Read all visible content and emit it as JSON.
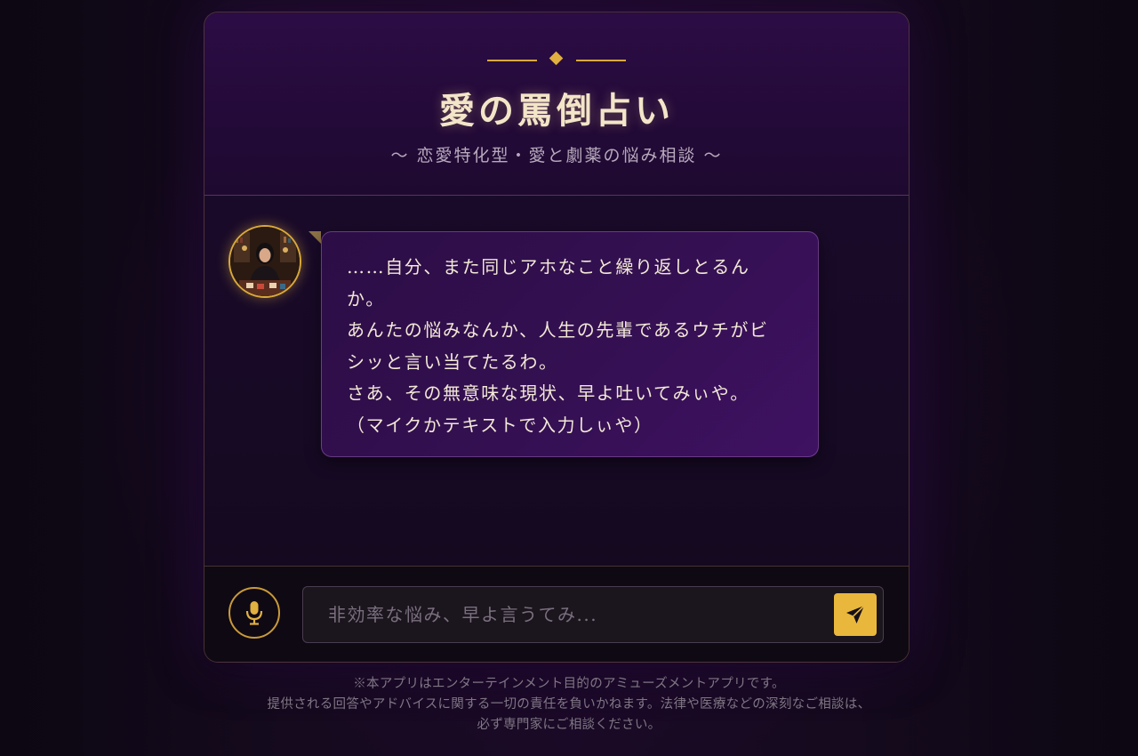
{
  "header": {
    "title": "愛の罵倒占い",
    "subtitle": "〜 恋愛特化型・愛と劇薬の悩み相談 〜"
  },
  "chat": {
    "messages": [
      {
        "sender": "fortune-teller",
        "text": "……自分、また同じアホなこと繰り返しとるん\nか。\nあんたの悩みなんか、人生の先輩であるウチがビ\nシッと言い当てたるわ。\nさあ、その無意味な現状、早よ吐いてみぃや。\n（マイクかテキストで入力しぃや）"
      }
    ]
  },
  "input": {
    "placeholder": "非効率な悩み、早よ言うてみ...",
    "value": ""
  },
  "disclaimer": {
    "line1": "※本アプリはエンターテインメント目的のアミューズメントアプリです。",
    "line2": "提供される回答やアドバイスに関する一切の責任を負いかねます。法律や医療などの深刻なご相談は、",
    "line3": "必ず専門家にご相談ください。"
  },
  "icons": {
    "mic": "microphone-icon",
    "send": "send-icon",
    "ornament": "diamond-ornament"
  },
  "colors": {
    "accent_gold": "#e9b73b",
    "title": "#f3e6c8",
    "bubble_bg": "#341052",
    "background": "#150a1e"
  }
}
